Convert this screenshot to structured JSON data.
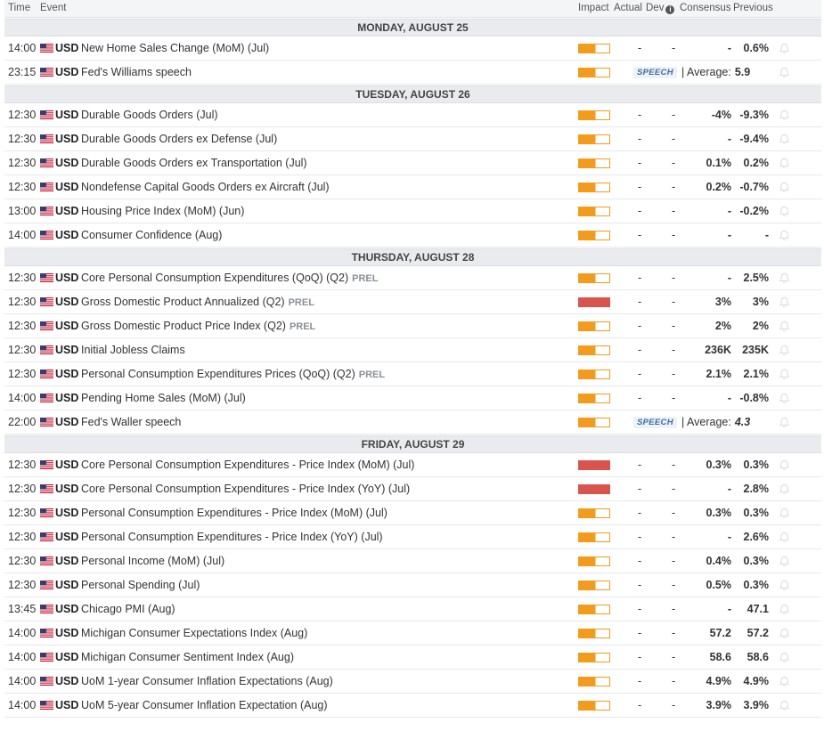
{
  "header": {
    "time": "Time",
    "event": "Event",
    "impact": "Impact",
    "actual": "Actual",
    "dev": "Dev",
    "consensus": "Consensus",
    "previous": "Previous"
  },
  "colors": {
    "medium_impact": "#f29b1d",
    "high_impact": "#d9534f"
  },
  "days": [
    {
      "label": "MONDAY, AUGUST 25",
      "rows": [
        {
          "time": "14:00",
          "currency": "USD",
          "event": "New Home Sales Change (MoM) (Jul)",
          "tag": "",
          "impact": "medium",
          "actual": "-",
          "dev": "-",
          "consensus": "-",
          "previous": "0.6%"
        },
        {
          "time": "23:15",
          "currency": "USD",
          "event": "Fed's Williams speech",
          "tag": "",
          "impact": "medium",
          "speech": "SPEECH",
          "avg_label": "| Average:",
          "avg_value": "5.9",
          "avg_italic": false
        }
      ]
    },
    {
      "label": "TUESDAY, AUGUST 26",
      "rows": [
        {
          "time": "12:30",
          "currency": "USD",
          "event": "Durable Goods Orders (Jul)",
          "tag": "",
          "impact": "medium",
          "actual": "-",
          "dev": "-",
          "consensus": "-4%",
          "previous": "-9.3%"
        },
        {
          "time": "12:30",
          "currency": "USD",
          "event": "Durable Goods Orders ex Defense (Jul)",
          "tag": "",
          "impact": "medium",
          "actual": "-",
          "dev": "-",
          "consensus": "-",
          "previous": "-9.4%"
        },
        {
          "time": "12:30",
          "currency": "USD",
          "event": "Durable Goods Orders ex Transportation (Jul)",
          "tag": "",
          "impact": "medium",
          "actual": "-",
          "dev": "-",
          "consensus": "0.1%",
          "previous": "0.2%"
        },
        {
          "time": "12:30",
          "currency": "USD",
          "event": "Nondefense Capital Goods Orders ex Aircraft (Jul)",
          "tag": "",
          "impact": "medium",
          "actual": "-",
          "dev": "-",
          "consensus": "0.2%",
          "previous": "-0.7%"
        },
        {
          "time": "13:00",
          "currency": "USD",
          "event": "Housing Price Index (MoM) (Jun)",
          "tag": "",
          "impact": "medium",
          "actual": "-",
          "dev": "-",
          "consensus": "-",
          "previous": "-0.2%"
        },
        {
          "time": "14:00",
          "currency": "USD",
          "event": "Consumer Confidence (Aug)",
          "tag": "",
          "impact": "medium",
          "actual": "-",
          "dev": "-",
          "consensus": "-",
          "previous": "-"
        }
      ]
    },
    {
      "label": "THURSDAY, AUGUST 28",
      "rows": [
        {
          "time": "12:30",
          "currency": "USD",
          "event": "Core Personal Consumption Expenditures (QoQ) (Q2)",
          "tag": "PREL",
          "impact": "medium",
          "actual": "-",
          "dev": "-",
          "consensus": "-",
          "previous": "2.5%"
        },
        {
          "time": "12:30",
          "currency": "USD",
          "event": "Gross Domestic Product Annualized (Q2)",
          "tag": "PREL",
          "impact": "high",
          "actual": "-",
          "dev": "-",
          "consensus": "3%",
          "previous": "3%"
        },
        {
          "time": "12:30",
          "currency": "USD",
          "event": "Gross Domestic Product Price Index (Q2)",
          "tag": "PREL",
          "impact": "medium",
          "actual": "-",
          "dev": "-",
          "consensus": "2%",
          "previous": "2%"
        },
        {
          "time": "12:30",
          "currency": "USD",
          "event": "Initial Jobless Claims",
          "tag": "",
          "impact": "medium",
          "actual": "-",
          "dev": "-",
          "consensus": "236K",
          "previous": "235K"
        },
        {
          "time": "12:30",
          "currency": "USD",
          "event": "Personal Consumption Expenditures Prices (QoQ) (Q2)",
          "tag": "PREL",
          "impact": "medium",
          "actual": "-",
          "dev": "-",
          "consensus": "2.1%",
          "previous": "2.1%"
        },
        {
          "time": "14:00",
          "currency": "USD",
          "event": "Pending Home Sales (MoM) (Jul)",
          "tag": "",
          "impact": "medium",
          "actual": "-",
          "dev": "-",
          "consensus": "-",
          "previous": "-0.8%"
        },
        {
          "time": "22:00",
          "currency": "USD",
          "event": "Fed's Waller speech",
          "tag": "",
          "impact": "medium",
          "speech": "SPEECH",
          "avg_label": "| Average:",
          "avg_value": "4.3",
          "avg_italic": true
        }
      ]
    },
    {
      "label": "FRIDAY, AUGUST 29",
      "rows": [
        {
          "time": "12:30",
          "currency": "USD",
          "event": "Core Personal Consumption Expenditures - Price Index (MoM) (Jul)",
          "tag": "",
          "impact": "high",
          "actual": "-",
          "dev": "-",
          "consensus": "0.3%",
          "previous": "0.3%"
        },
        {
          "time": "12:30",
          "currency": "USD",
          "event": "Core Personal Consumption Expenditures - Price Index (YoY) (Jul)",
          "tag": "",
          "impact": "high",
          "actual": "-",
          "dev": "-",
          "consensus": "-",
          "previous": "2.8%"
        },
        {
          "time": "12:30",
          "currency": "USD",
          "event": "Personal Consumption Expenditures - Price Index (MoM) (Jul)",
          "tag": "",
          "impact": "medium",
          "actual": "-",
          "dev": "-",
          "consensus": "0.3%",
          "previous": "0.3%"
        },
        {
          "time": "12:30",
          "currency": "USD",
          "event": "Personal Consumption Expenditures - Price Index (YoY) (Jul)",
          "tag": "",
          "impact": "medium",
          "actual": "-",
          "dev": "-",
          "consensus": "-",
          "previous": "2.6%"
        },
        {
          "time": "12:30",
          "currency": "USD",
          "event": "Personal Income (MoM) (Jul)",
          "tag": "",
          "impact": "medium",
          "actual": "-",
          "dev": "-",
          "consensus": "0.4%",
          "previous": "0.3%"
        },
        {
          "time": "12:30",
          "currency": "USD",
          "event": "Personal Spending (Jul)",
          "tag": "",
          "impact": "medium",
          "actual": "-",
          "dev": "-",
          "consensus": "0.5%",
          "previous": "0.3%"
        },
        {
          "time": "13:45",
          "currency": "USD",
          "event": "Chicago PMI (Aug)",
          "tag": "",
          "impact": "medium",
          "actual": "-",
          "dev": "-",
          "consensus": "-",
          "previous": "47.1"
        },
        {
          "time": "14:00",
          "currency": "USD",
          "event": "Michigan Consumer Expectations Index (Aug)",
          "tag": "",
          "impact": "medium",
          "actual": "-",
          "dev": "-",
          "consensus": "57.2",
          "previous": "57.2"
        },
        {
          "time": "14:00",
          "currency": "USD",
          "event": "Michigan Consumer Sentiment Index (Aug)",
          "tag": "",
          "impact": "medium",
          "actual": "-",
          "dev": "-",
          "consensus": "58.6",
          "previous": "58.6"
        },
        {
          "time": "14:00",
          "currency": "USD",
          "event": "UoM 1-year Consumer Inflation Expectations (Aug)",
          "tag": "",
          "impact": "medium",
          "actual": "-",
          "dev": "-",
          "consensus": "4.9%",
          "previous": "4.9%"
        },
        {
          "time": "14:00",
          "currency": "USD",
          "event": "UoM 5-year Consumer Inflation Expectation (Aug)",
          "tag": "",
          "impact": "medium",
          "actual": "-",
          "dev": "-",
          "consensus": "3.9%",
          "previous": "3.9%"
        }
      ]
    }
  ]
}
